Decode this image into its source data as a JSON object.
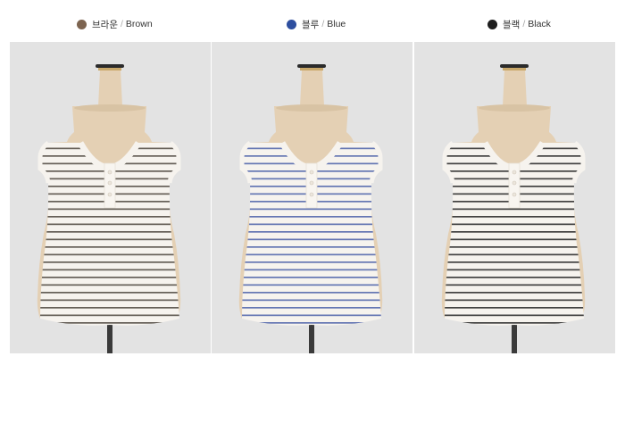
{
  "variants": [
    {
      "name_ko": "브라운",
      "name_en": "Brown",
      "swatch": "#7d6450",
      "stripe": "#4b443c"
    },
    {
      "name_ko": "블루",
      "name_en": "Blue",
      "swatch": "#2e4f9f",
      "stripe": "#4a5fa8"
    },
    {
      "name_ko": "블랙",
      "name_en": "Black",
      "swatch": "#1e1e1e",
      "stripe": "#222222"
    }
  ],
  "separator": "/"
}
